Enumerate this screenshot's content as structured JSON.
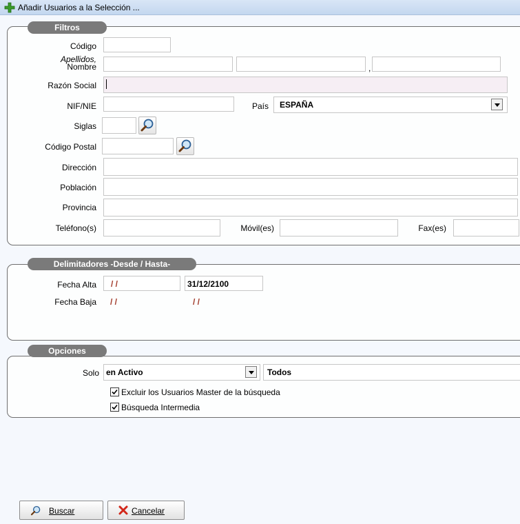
{
  "window": {
    "title": "Añadir Usuarios a la Selección ..."
  },
  "filtros": {
    "legend": "Filtros",
    "codigo_label": "Código",
    "apellidos_label": "Apellidos,",
    "nombre_label": "Nombre",
    "name_separator": ",",
    "razon_social_label": "Razón Social",
    "nif_label": "NIF/NIE",
    "pais_label": "País",
    "pais_value": "ESPAÑA",
    "siglas_label": "Siglas",
    "codigo_postal_label": "Código Postal",
    "direccion_label": "Dirección",
    "poblacion_label": "Población",
    "provincia_label": "Provincia",
    "telefono_label": "Teléfono(s)",
    "movil_label": "Móvil(es)",
    "fax_label": "Fax(es)"
  },
  "delimitadores": {
    "legend": "Delimitadores -Desde / Hasta-",
    "fecha_alta_label": "Fecha Alta",
    "fecha_alta_desde": "/ /",
    "fecha_alta_hasta": "31/12/2100",
    "fecha_baja_label": "Fecha Baja",
    "fecha_baja_desde": "/ /",
    "fecha_baja_hasta": "/ /"
  },
  "opciones": {
    "legend": "Opciones",
    "solo_label": "Solo",
    "solo_value": "en Activo",
    "todos_value": "Todos",
    "excluir_label": "Excluir los Usuarios Master de la búsqueda",
    "excluir_checked": true,
    "intermedia_label": "Búsqueda Intermedia",
    "intermedia_checked": true
  },
  "buttons": {
    "buscar_mnemonic": "B",
    "buscar_rest": "uscar",
    "cancelar_mnemonic": "C",
    "cancelar_rest": "ancelar"
  },
  "icons": {
    "title_icon": "green-plus-icon",
    "search_icon": "magnifier-icon",
    "cancel_icon": "red-x-icon",
    "dropdown_icon": "chevron-down-icon",
    "checkbox_icon": "checkmark-icon"
  },
  "colors": {
    "legend_bg": "#7a7a7a",
    "date_red": "#a23a2a",
    "titlebar": "#c8daf0",
    "razon_social_bg": "#f6eef4"
  }
}
